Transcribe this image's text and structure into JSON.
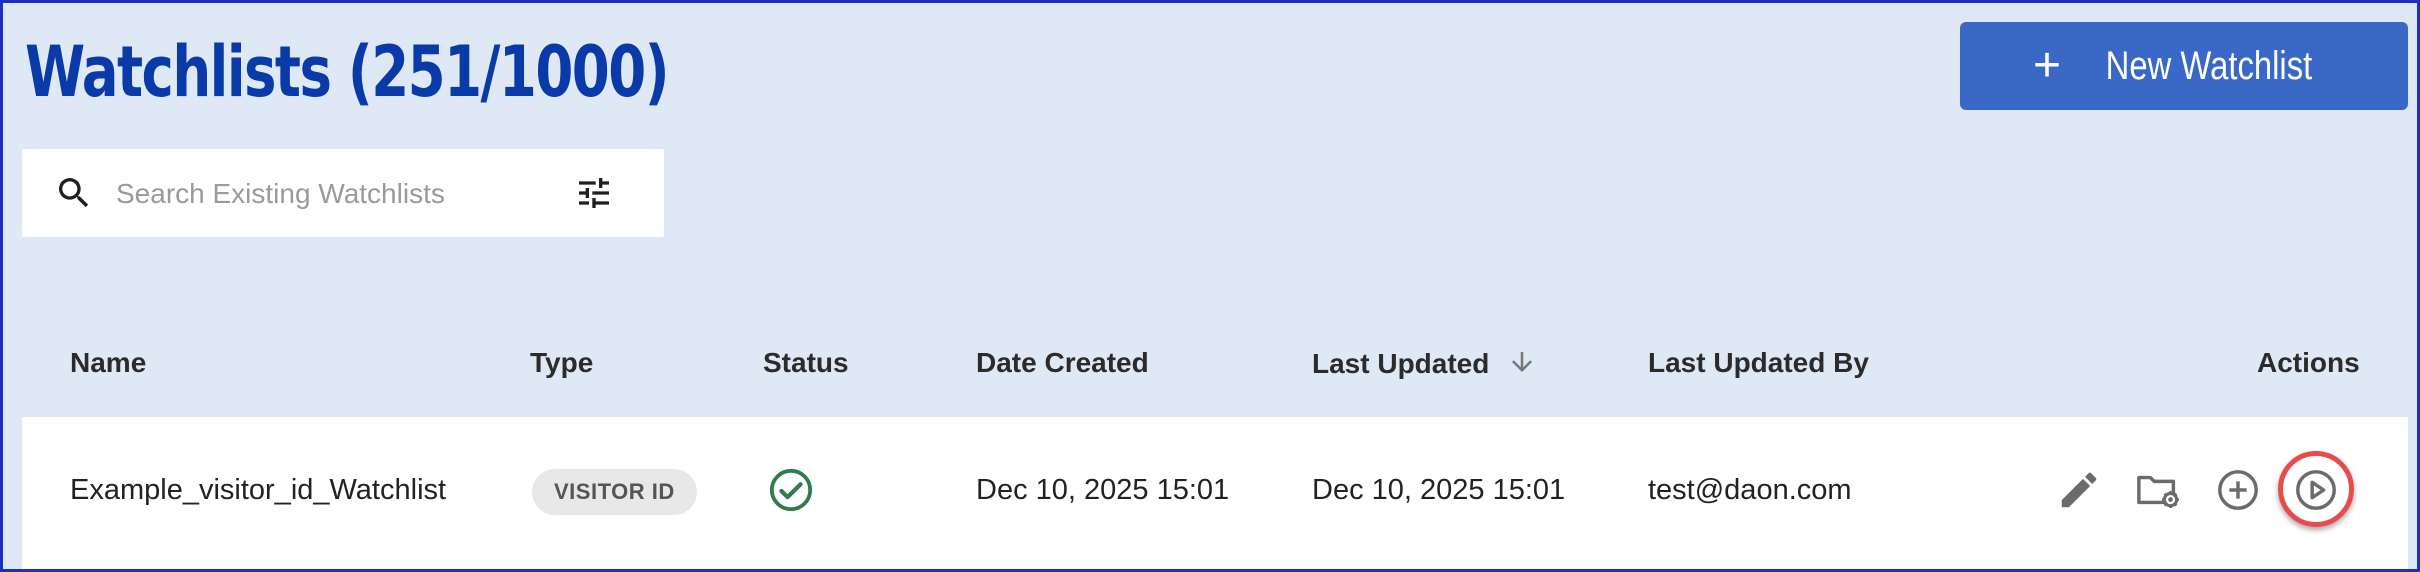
{
  "header": {
    "title": "Watchlists (251/1000)",
    "new_button_label": "New Watchlist",
    "new_button_icon": "plus-icon"
  },
  "search": {
    "placeholder": "Search Existing Watchlists",
    "value": "",
    "icon": "search-icon",
    "filter_icon": "tune-icon"
  },
  "table": {
    "columns": [
      "Name",
      "Type",
      "Status",
      "Date Created",
      "Last Updated",
      "Last Updated By",
      "Actions"
    ],
    "sort_column": "Last Updated",
    "sort_direction": "descending",
    "rows": [
      {
        "name": "Example_visitor_id_Watchlist",
        "type": "VISITOR ID",
        "status_icon": "check-circle-icon",
        "date_created": "Dec 10, 2025 15:01",
        "last_updated": "Dec 10, 2025 15:01",
        "last_updated_by": "test@daon.com",
        "actions": [
          "edit-icon",
          "folder-settings-icon",
          "add-circle-icon",
          "play-circle-icon"
        ]
      }
    ]
  },
  "colors": {
    "title": "#0a3aa8",
    "primary_button": "#3a68c6",
    "page_background": "#dfe8f5",
    "status_ok": "#2e7d4f",
    "highlight": "#e84b4b"
  }
}
